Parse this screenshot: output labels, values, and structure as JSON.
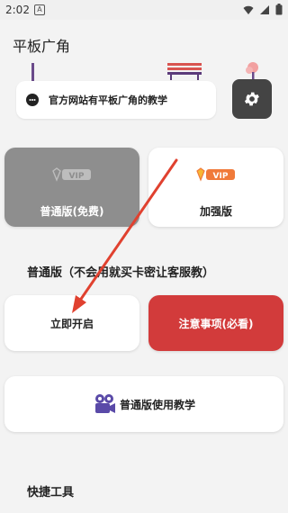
{
  "status_bar": {
    "time": "2:02",
    "notification_icon": "A"
  },
  "app": {
    "title": "平板广角"
  },
  "banner": {
    "text": "官方网站有平板广角的教学"
  },
  "cards": {
    "basic_label": "普通版(免费)",
    "plus_label": "加强版",
    "vip_text": "VIP"
  },
  "section": {
    "title": "普通版（不会用就买卡密让客服教）"
  },
  "buttons": {
    "start": "立即开启",
    "notes": "注意事项(必看)",
    "tutorial": "普通版使用教学"
  },
  "footer": {
    "quick_tools": "快捷工具"
  },
  "colors": {
    "notes_red": "#d23b3b",
    "basic_gray": "#8e8e8e",
    "vip_orange": "#f07a3a",
    "settings_dark": "#444444",
    "arrow_red": "#e0412f"
  }
}
